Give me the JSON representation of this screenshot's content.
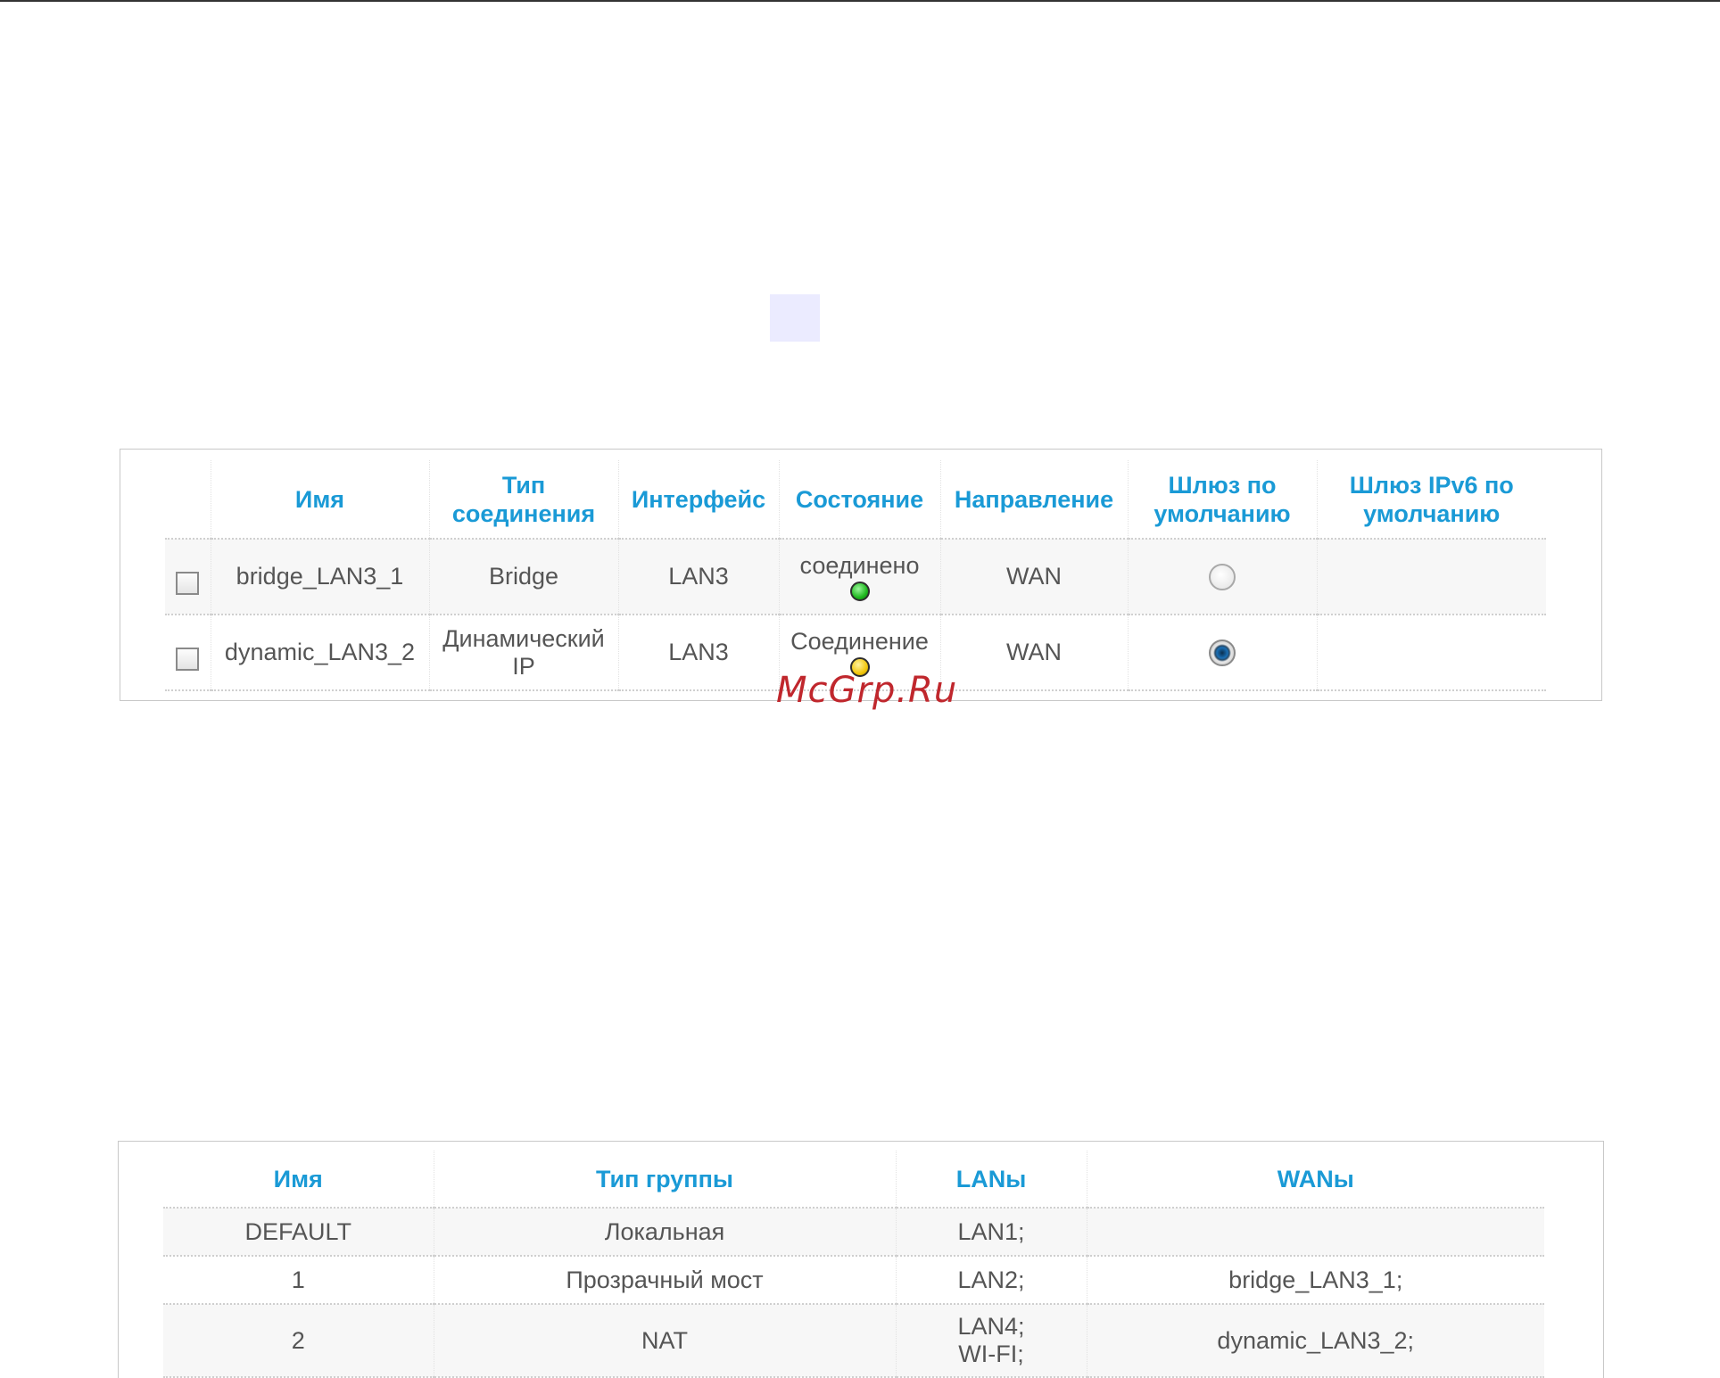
{
  "connections_table": {
    "headers": {
      "name": "Имя",
      "type": "Тип соединения",
      "interface": "Интерфейс",
      "state": "Состояние",
      "direction": "Направление",
      "default_gw": "Шлюз по умолчанию",
      "default_gw_ipv6": "Шлюз IPv6 по умолчанию"
    },
    "rows": [
      {
        "name": "bridge_LAN3_1",
        "type": "Bridge",
        "interface": "LAN3",
        "state": "соединено",
        "state_color": "#1fb81f",
        "direction": "WAN",
        "default_gw_selected": false,
        "checked": false
      },
      {
        "name": "dynamic_LAN3_2",
        "type": "Динамический IP",
        "interface": "LAN3",
        "state": "Соединение",
        "state_color": "#f2c70c",
        "direction": "WAN",
        "default_gw_selected": true,
        "checked": false
      }
    ]
  },
  "groups_table": {
    "headers": {
      "name": "Имя",
      "group_type": "Тип группы",
      "lans": "LANы",
      "wans": "WANы"
    },
    "rows": [
      {
        "name": "DEFAULT",
        "group_type": "Локальная",
        "lans": [
          "LAN1;"
        ],
        "wans": ""
      },
      {
        "name": "1",
        "group_type": "Прозрачный мост",
        "lans": [
          "LAN2;"
        ],
        "wans": "bridge_LAN3_1;"
      },
      {
        "name": "2",
        "group_type": "NAT",
        "lans": [
          "LAN4;",
          "WI-FI;"
        ],
        "wans": "dynamic_LAN3_2;"
      }
    ]
  },
  "watermark": "McGrp.Ru",
  "colors": {
    "header_text": "#1a9ad6",
    "body_text": "#555555",
    "watermark": "#c0272d"
  }
}
